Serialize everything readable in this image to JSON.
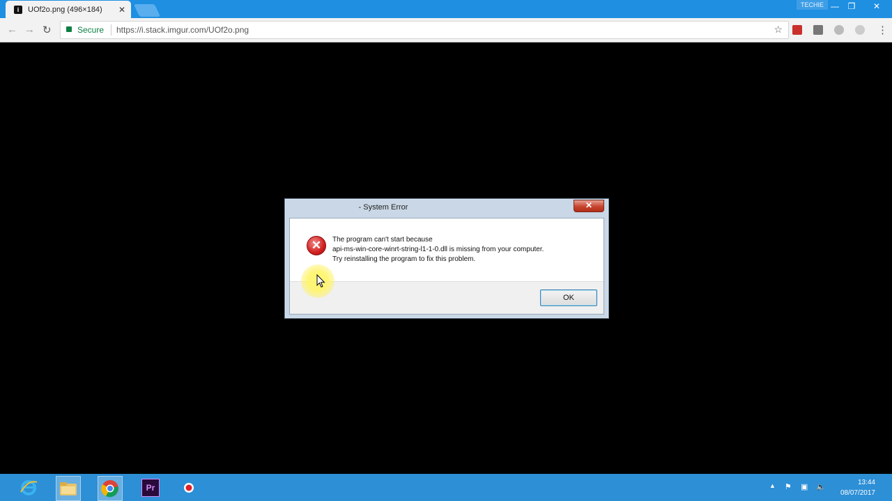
{
  "browser": {
    "tab_title": "UOf2o.png (496×184)",
    "tab_close": "✕",
    "profile_label": "TECHIE",
    "window_controls": {
      "minimize": "—",
      "restore": "❐",
      "close": "✕"
    },
    "secure_label": "Secure",
    "url": "https://i.stack.imgur.com/UOf2o.png",
    "icons": [
      "back-icon",
      "forward-icon",
      "reload-icon",
      "lock-icon",
      "bookmark-star-icon",
      "menu-icon"
    ]
  },
  "dialog": {
    "title": "- System Error",
    "close": "✕",
    "message_line1": "The program can't start because",
    "message_line2": "api-ms-win-core-winrt-string-l1-1-0.dll is missing from your computer.",
    "message_line3": "Try reinstalling the program to fix this problem.",
    "error_icon_glyph": "✕",
    "ok_label": "OK"
  },
  "taskbar": {
    "time": "13:44",
    "date": "08/07/2017",
    "apps": [
      "internet-explorer-icon",
      "file-explorer-icon",
      "chrome-icon",
      "premiere-pro-icon",
      "recorder-icon"
    ],
    "premiere_label": "Pr"
  },
  "colors": {
    "taskbar": "#2d8fd6",
    "tabstrip": "#1e8fe1",
    "secure": "#0b8043",
    "error": "#d12020"
  }
}
